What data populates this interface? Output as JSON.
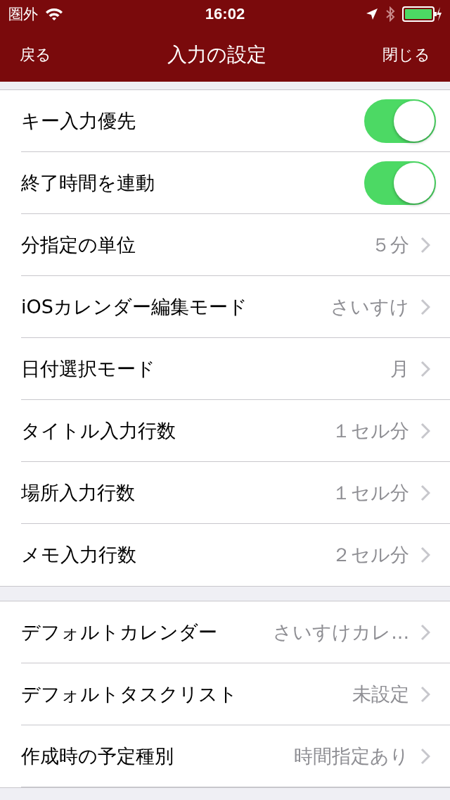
{
  "status_bar": {
    "carrier": "圏外",
    "time": "16:02"
  },
  "nav": {
    "back": "戻る",
    "title": "入力の設定",
    "close": "閉じる"
  },
  "sections": [
    {
      "rows": [
        {
          "kind": "toggle",
          "label": "キー入力優先",
          "on": true
        },
        {
          "kind": "toggle",
          "label": "終了時間を連動",
          "on": true
        },
        {
          "kind": "disclosure",
          "label": "分指定の単位",
          "value": "５分"
        },
        {
          "kind": "disclosure",
          "label": "iOSカレンダー編集モード",
          "value": "さいすけ"
        },
        {
          "kind": "disclosure",
          "label": "日付選択モード",
          "value": "月"
        },
        {
          "kind": "disclosure",
          "label": "タイトル入力行数",
          "value": "１セル分"
        },
        {
          "kind": "disclosure",
          "label": "場所入力行数",
          "value": "１セル分"
        },
        {
          "kind": "disclosure",
          "label": "メモ入力行数",
          "value": "２セル分"
        }
      ]
    },
    {
      "rows": [
        {
          "kind": "disclosure",
          "label": "デフォルトカレンダー",
          "value": "さいすけカレ..."
        },
        {
          "kind": "disclosure",
          "label": "デフォルトタスクリスト",
          "value": "未設定"
        },
        {
          "kind": "disclosure",
          "label": "作成時の予定種別",
          "value": "時間指定あり"
        }
      ]
    }
  ]
}
